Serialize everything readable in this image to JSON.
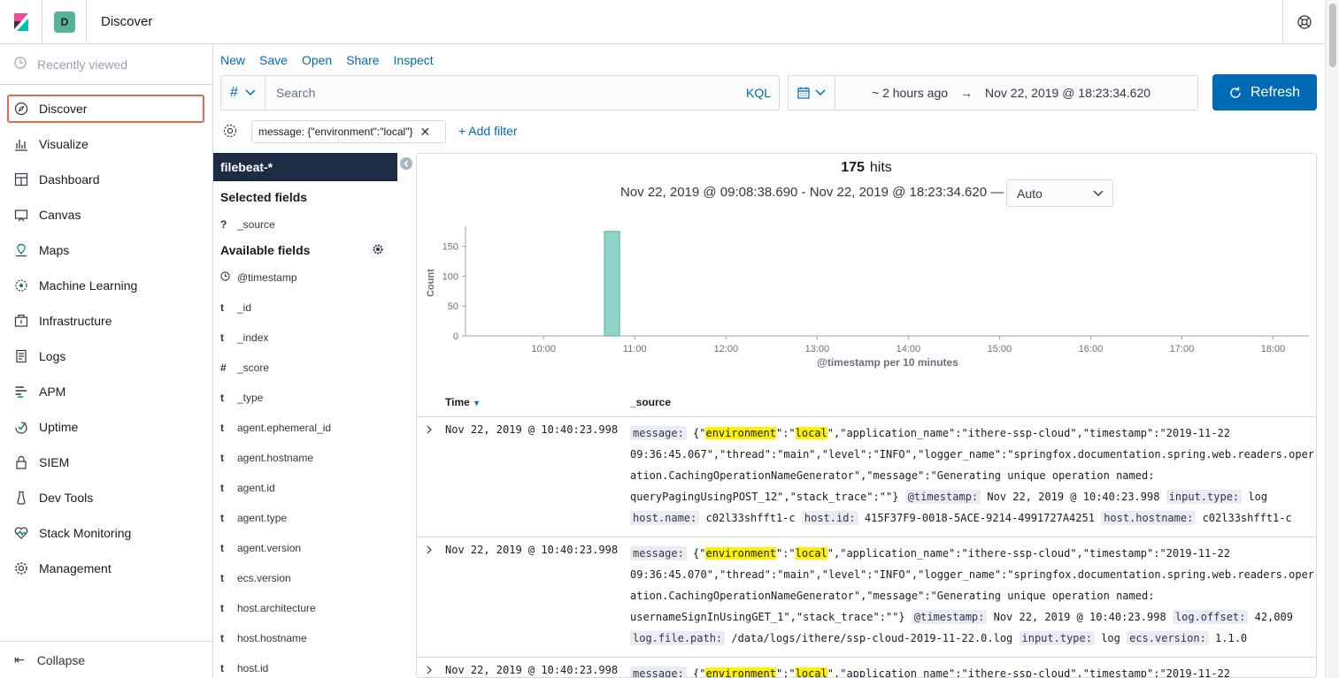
{
  "header": {
    "space_initial": "D",
    "breadcrumb": "Discover"
  },
  "nav": {
    "recent": "Recently viewed",
    "items": [
      {
        "label": "Discover",
        "icon": "compass-icon",
        "active": true
      },
      {
        "label": "Visualize",
        "icon": "visualize-icon"
      },
      {
        "label": "Dashboard",
        "icon": "dashboard-icon"
      },
      {
        "label": "Canvas",
        "icon": "canvas-icon"
      },
      {
        "label": "Maps",
        "icon": "maps-icon"
      },
      {
        "label": "Machine Learning",
        "icon": "machine-learning-icon"
      },
      {
        "label": "Infrastructure",
        "icon": "infrastructure-icon"
      },
      {
        "label": "Logs",
        "icon": "logs-icon"
      },
      {
        "label": "APM",
        "icon": "apm-icon"
      },
      {
        "label": "Uptime",
        "icon": "uptime-icon"
      },
      {
        "label": "SIEM",
        "icon": "siem-icon"
      },
      {
        "label": "Dev Tools",
        "icon": "dev-tools-icon"
      },
      {
        "label": "Stack Monitoring",
        "icon": "stack-monitoring-icon"
      },
      {
        "label": "Management",
        "icon": "management-icon"
      }
    ],
    "collapse": "Collapse"
  },
  "menu": {
    "new": "New",
    "save": "Save",
    "open": "Open",
    "share": "Share",
    "inspect": "Inspect"
  },
  "query": {
    "lang_symbol": "#",
    "placeholder": "Search",
    "kql": "KQL"
  },
  "time": {
    "from": "~ 2 hours ago",
    "arrow": "→",
    "to": "Nov 22, 2019 @ 18:23:34.620",
    "refresh": "Refresh"
  },
  "filters": {
    "pill": "message: {\"environment\":\"local\"}",
    "add": "+ Add filter"
  },
  "sidebar": {
    "index_pattern": "filebeat-*",
    "selected_title": "Selected fields",
    "selected": [
      {
        "type": "?",
        "name": "_source"
      }
    ],
    "available_title": "Available fields",
    "available": [
      {
        "type": "clock",
        "name": "@timestamp"
      },
      {
        "type": "t",
        "name": "_id"
      },
      {
        "type": "t",
        "name": "_index"
      },
      {
        "type": "#",
        "name": "_score"
      },
      {
        "type": "t",
        "name": "_type"
      },
      {
        "type": "t",
        "name": "agent.ephemeral_id"
      },
      {
        "type": "t",
        "name": "agent.hostname"
      },
      {
        "type": "t",
        "name": "agent.id"
      },
      {
        "type": "t",
        "name": "agent.type"
      },
      {
        "type": "t",
        "name": "agent.version"
      },
      {
        "type": "t",
        "name": "ecs.version"
      },
      {
        "type": "t",
        "name": "host.architecture"
      },
      {
        "type": "t",
        "name": "host.hostname"
      },
      {
        "type": "t",
        "name": "host.id"
      }
    ]
  },
  "results": {
    "hits_count": "175",
    "hits_label": "hits",
    "range": "Nov 22, 2019 @ 09:08:38.690 - Nov 22, 2019 @ 18:23:34.620 —",
    "interval": "Auto",
    "col_time": "Time",
    "col_source": "_source",
    "rows": [
      {
        "time": "Nov 22, 2019 @ 10:40:23.998",
        "lines": [
          [
            [
              "k",
              "message:"
            ],
            [
              "t",
              " {\""
            ],
            [
              "h",
              "environment"
            ],
            [
              "t",
              "\":\""
            ],
            [
              "h",
              "local"
            ],
            [
              "t",
              "\",\"application_name\":\"ithere-ssp-cloud\",\"timestamp\":\"2019-11-22"
            ]
          ],
          [
            [
              "t",
              "09:36:45.067\",\"thread\":\"main\",\"level\":\"INFO\",\"logger_name\":\"springfox.documentation.spring.web.readers.oper"
            ]
          ],
          [
            [
              "t",
              "ation.CachingOperationNameGenerator\",\"message\":\"Generating unique operation named:"
            ]
          ],
          [
            [
              "t",
              "queryPagingUsingPOST_12\",\"stack_trace\":\"\"} "
            ],
            [
              "k",
              "@timestamp:"
            ],
            [
              "t",
              " Nov 22, 2019 @ 10:40:23.998 "
            ],
            [
              "k",
              "input.type:"
            ],
            [
              "t",
              " log"
            ]
          ],
          [
            [
              "k",
              "host.name:"
            ],
            [
              "t",
              " c02l33shfft1-c "
            ],
            [
              "k",
              "host.id:"
            ],
            [
              "t",
              " 415F37F9-0018-5ACE-9214-4991727A4251 "
            ],
            [
              "k",
              "host.hostname:"
            ],
            [
              "t",
              " c02l33shfft1-c"
            ]
          ]
        ]
      },
      {
        "time": "Nov 22, 2019 @ 10:40:23.998",
        "lines": [
          [
            [
              "k",
              "message:"
            ],
            [
              "t",
              " {\""
            ],
            [
              "h",
              "environment"
            ],
            [
              "t",
              "\":\""
            ],
            [
              "h",
              "local"
            ],
            [
              "t",
              "\",\"application_name\":\"ithere-ssp-cloud\",\"timestamp\":\"2019-11-22"
            ]
          ],
          [
            [
              "t",
              "09:36:45.070\",\"thread\":\"main\",\"level\":\"INFO\",\"logger_name\":\"springfox.documentation.spring.web.readers.oper"
            ]
          ],
          [
            [
              "t",
              "ation.CachingOperationNameGenerator\",\"message\":\"Generating unique operation named:"
            ]
          ],
          [
            [
              "t",
              "usernameSignInUsingGET_1\",\"stack_trace\":\"\"} "
            ],
            [
              "k",
              "@timestamp:"
            ],
            [
              "t",
              " Nov 22, 2019 @ 10:40:23.998 "
            ],
            [
              "k",
              "log.offset:"
            ],
            [
              "t",
              " 42,009"
            ]
          ],
          [
            [
              "k",
              "log.file.path:"
            ],
            [
              "t",
              " /data/logs/ithere/ssp-cloud-2019-11-22.0.log "
            ],
            [
              "k",
              "input.type:"
            ],
            [
              "t",
              " log "
            ],
            [
              "k",
              "ecs.version:"
            ],
            [
              "t",
              " 1.1.0"
            ]
          ]
        ]
      },
      {
        "time": "Nov 22, 2019 @ 10:40:23.998",
        "lines": [
          [
            [
              "k",
              "message:"
            ],
            [
              "t",
              " {\""
            ],
            [
              "h",
              "environment"
            ],
            [
              "t",
              "\":\""
            ],
            [
              "h",
              "local"
            ],
            [
              "t",
              "\",\"application_name\":\"ithere-ssp-cloud\",\"timestamp\":\"2019-11-22"
            ]
          ]
        ]
      }
    ]
  },
  "chart_data": {
    "type": "bar",
    "xlabel": "@timestamp per 10 minutes",
    "ylabel": "Count",
    "yticks": [
      0,
      50,
      100,
      150
    ],
    "xticks": [
      "10:00",
      "11:00",
      "12:00",
      "13:00",
      "14:00",
      "15:00",
      "16:00",
      "17:00",
      "18:00"
    ],
    "x_range": [
      "09:08",
      "18:23"
    ],
    "ylim": [
      0,
      180
    ],
    "bars": [
      {
        "x": "10:40",
        "value": 175
      }
    ],
    "bar_color": "#8fd3c9"
  }
}
